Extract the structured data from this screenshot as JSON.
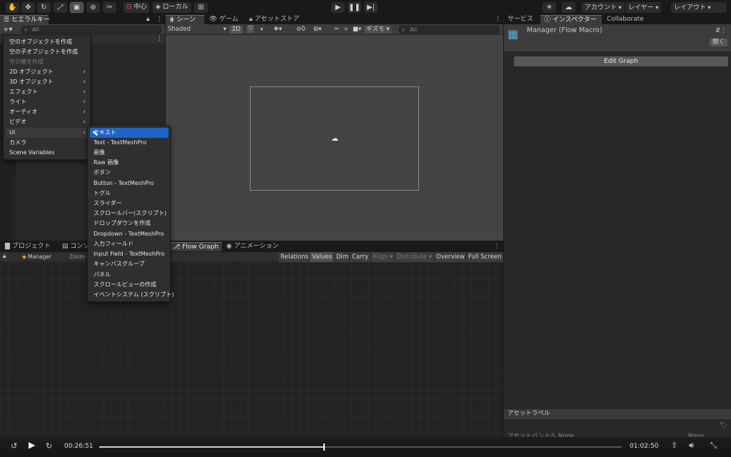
{
  "toolbar": {
    "tools": [
      "hand-tool",
      "move-tool",
      "rotate-tool",
      "scale-tool",
      "rect-tool",
      "transform-tool",
      "custom-tool"
    ],
    "pivot": "中心",
    "space": "ローカル",
    "account": "アカウント",
    "layers": "レイヤー",
    "layout": "レイアウト"
  },
  "hierarchy": {
    "tab": "ヒエラルキー",
    "search_placeholder": "All"
  },
  "scene": {
    "tabs": [
      "シーン",
      "ゲーム",
      "アセットストア"
    ],
    "shading": "Shaded",
    "mode_2d": "2D",
    "hidden_count": "0",
    "gizmos": "ギズモ",
    "search_placeholder": "All"
  },
  "bottom": {
    "tabs": [
      "プロジェクト",
      "コンソ",
      "Flow Graph",
      "アニメーション"
    ],
    "graph_name": "Manager",
    "zoom_label": "Zoom -",
    "graph_buttons": [
      "Relations",
      "Values",
      "Dim",
      "Carry",
      "Align",
      "Distribute",
      "Overview",
      "Full Screen"
    ]
  },
  "right": {
    "tabs": [
      "サービス",
      "インスペクター",
      "Collaborate"
    ],
    "object_name": "Manager (Flow Macro)",
    "open_button": "開く",
    "edit_graph": "Edit Graph",
    "asset_labels": "アセットラベル",
    "asset_bundle": "アセットバンドル",
    "none1": "None",
    "none2": "None"
  },
  "context_menu": {
    "items": [
      {
        "label": "空のオブジェクトを作成"
      },
      {
        "label": "空の子オブジェクトを作成"
      },
      {
        "label": "空の親を作成"
      },
      {
        "label": "2D オブジェクト"
      },
      {
        "label": "3D オブジェクト"
      },
      {
        "label": "エフェクト"
      },
      {
        "label": "ライト"
      },
      {
        "label": "オーディオ"
      },
      {
        "label": "ビデオ"
      },
      {
        "label": "UI"
      },
      {
        "label": "カメラ"
      },
      {
        "label": "Scene Variables"
      }
    ]
  },
  "ui_submenu": {
    "items": [
      "テキスト",
      "Text - TextMeshPro",
      "画像",
      "Raw 画像",
      "ボタン",
      "Button - TextMeshPro",
      "トグル",
      "スライダー",
      "スクロールバー(スクリプト)",
      "ドロップダウンを作成",
      "Dropdown - TextMeshPro",
      "入力フィールド",
      "Input Field - TextMeshPro",
      "キャンバスグループ",
      "パネル",
      "スクロールビューの作成",
      "イベントシステム (スクリプト)"
    ]
  },
  "video": {
    "current_time": "00:26:51",
    "total_time": "01:02:50",
    "progress": 0.43
  }
}
